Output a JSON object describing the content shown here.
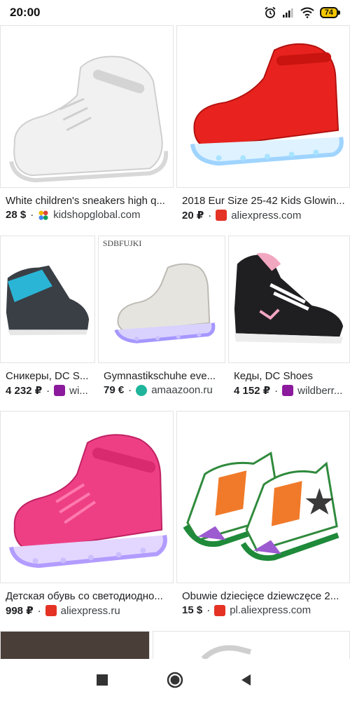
{
  "status": {
    "time": "20:00",
    "battery": "74",
    "icons": [
      "alarm-icon",
      "signal-icon",
      "wifi-icon",
      "battery-icon"
    ]
  },
  "results": [
    {
      "caption": "White children's sneakers high q...",
      "price": "28 $",
      "source": "kidshopglobal.com",
      "favicon": "kidshopglobal-favicon"
    },
    {
      "caption": "2018 Eur Size 25-42 Kids Glowin...",
      "price": "20 ₽",
      "source": "aliexpress.com",
      "favicon": "aliexpress-favicon"
    },
    {
      "caption": "Сникеры, DC S...",
      "price": "4 232 ₽",
      "source": "wi...",
      "favicon": "wildberries-favicon"
    },
    {
      "caption": "Gymnastikschuhe eve...",
      "price": "79 €",
      "source": "amaazoon.ru",
      "favicon": "amaazoon-favicon",
      "image_text": "SDBFUJKI"
    },
    {
      "caption": "Кеды, DC Shoes",
      "price": "4 152 ₽",
      "source": "wildberr...",
      "favicon": "wildberries-favicon"
    },
    {
      "caption": "Детская обувь со светодиодно...",
      "price": "998 ₽",
      "source": "aliexpress.ru",
      "favicon": "aliexpress-favicon"
    },
    {
      "caption": "Obuwie dziecięce dziewczęce 2...",
      "price": "15 $",
      "source": "pl.aliexpress.com",
      "favicon": "aliexpress-favicon"
    }
  ],
  "nav": {
    "icons": [
      "recents-square-icon",
      "home-circle-icon",
      "back-triangle-icon"
    ]
  },
  "colors": {
    "aliexpress": "#e43225",
    "wildberries": "#8b1a9c",
    "amaazoon": "#1fb59c"
  }
}
